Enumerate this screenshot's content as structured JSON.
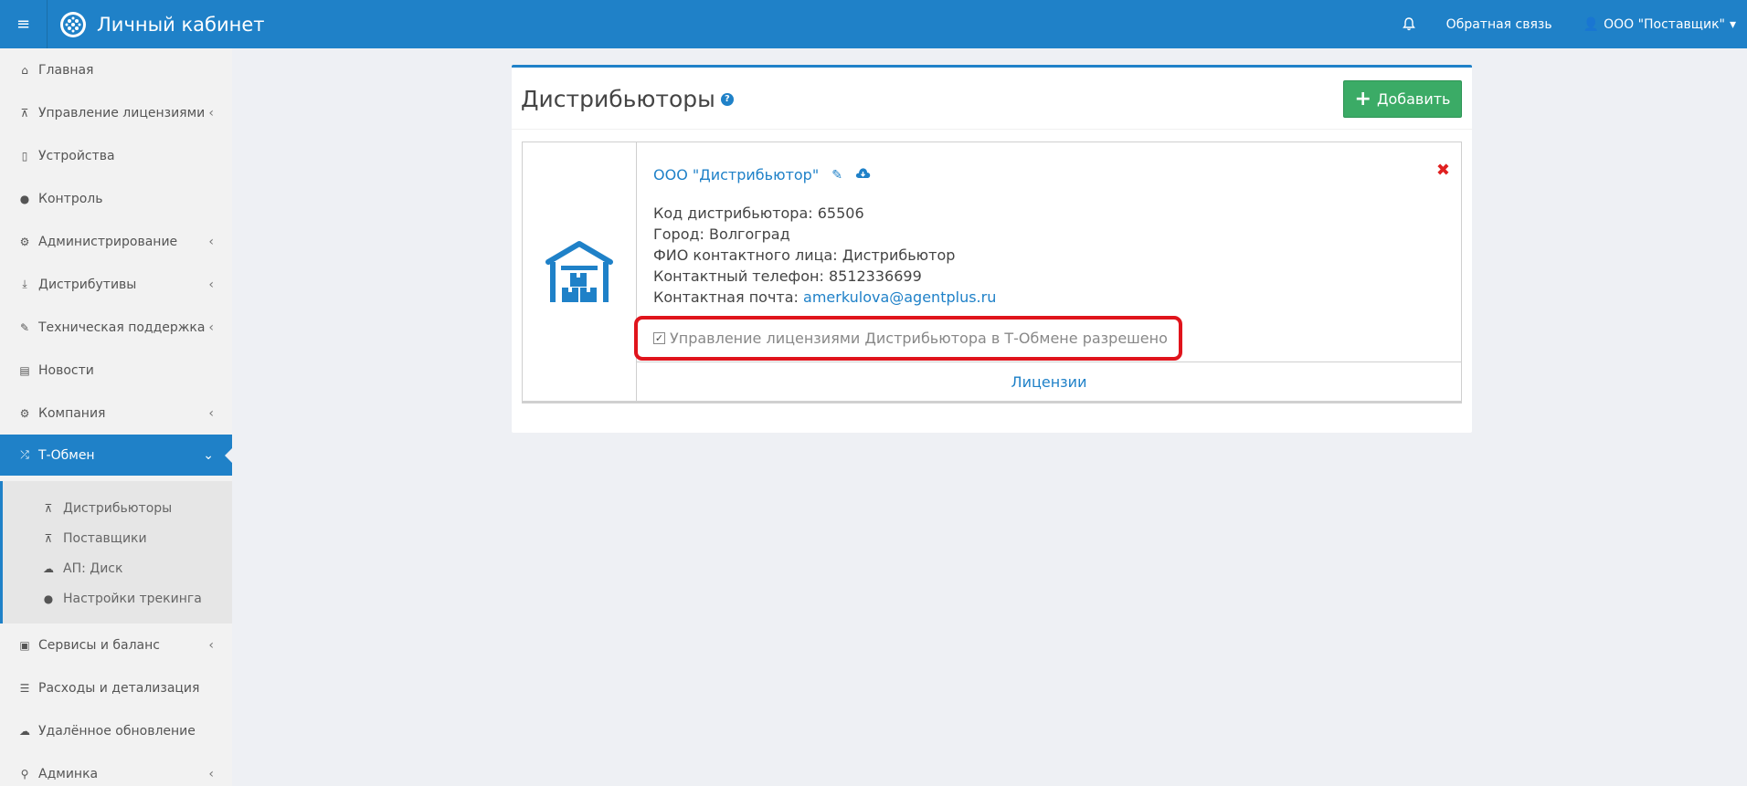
{
  "topbar": {
    "menu_icon": "hamburger-icon",
    "title": "Личный кабинет",
    "feedback": "Обратная связь",
    "user": "ООО \"Поставщик\"",
    "accent": "#1f81c8"
  },
  "sidebar": {
    "items": [
      {
        "label": "Главная",
        "icon": "home-icon",
        "chevron": ""
      },
      {
        "label": "Управление лицензиями",
        "icon": "sitemap-icon",
        "chevron": "‹"
      },
      {
        "label": "Устройства",
        "icon": "mobile-icon",
        "chevron": ""
      },
      {
        "label": "Контроль",
        "icon": "globe-icon",
        "chevron": ""
      },
      {
        "label": "Администрирование",
        "icon": "cogs-icon",
        "chevron": "‹"
      },
      {
        "label": "Дистрибутивы",
        "icon": "download-icon",
        "chevron": "‹"
      },
      {
        "label": "Техническая поддержка",
        "icon": "wrench-icon",
        "chevron": "‹"
      },
      {
        "label": "Новости",
        "icon": "newspaper-icon",
        "chevron": ""
      },
      {
        "label": "Компания",
        "icon": "gear-icon",
        "chevron": "‹"
      },
      {
        "label": "Т-Обмен",
        "icon": "random-icon",
        "chevron": "⌄"
      }
    ],
    "subitems": [
      {
        "label": "Дистрибьюторы",
        "icon": "sitemap-icon"
      },
      {
        "label": "Поставщики",
        "icon": "sitemap-icon"
      },
      {
        "label": "АП: Диск",
        "icon": "cloud-icon"
      },
      {
        "label": "Настройки трекинга",
        "icon": "globe-icon"
      }
    ],
    "items_after": [
      {
        "label": "Сервисы и баланс",
        "icon": "money-icon",
        "chevron": "‹"
      },
      {
        "label": "Расходы и детализация",
        "icon": "list-icon",
        "chevron": ""
      },
      {
        "label": "Удалённое обновление",
        "icon": "cloud-upload-icon",
        "chevron": ""
      },
      {
        "label": "Админка",
        "icon": "search-icon",
        "chevron": "‹"
      }
    ]
  },
  "main": {
    "title": "Дистрибьюторы",
    "add_label": "Добавить",
    "add_color": "#3bab66",
    "distributor": {
      "name": "ООО \"Дистрибьютор\"",
      "code_label": "Код дистрибьютора:",
      "code": "65506",
      "city_label": "Город:",
      "city": "Волгоград",
      "contact_label": "ФИО контактного лица:",
      "contact": "Дистрибьютор",
      "phone_label": "Контактный телефон:",
      "phone": "8512336699",
      "email_label": "Контактная почта:",
      "email": "amerkulova@agentplus.ru",
      "permission": "Управление лицензиями Дистрибьютора в Т-Обмене разрешено",
      "permission_checked": true,
      "licenses_link": "Лицензии"
    }
  }
}
